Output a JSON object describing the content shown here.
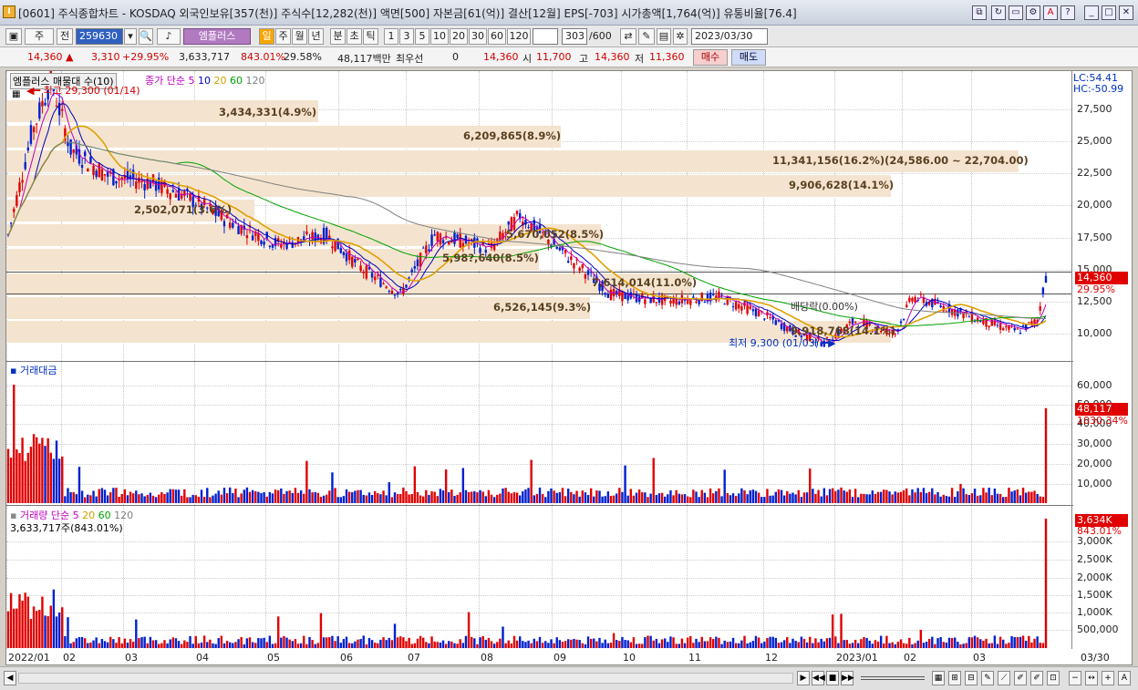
{
  "window": {
    "title": "[0601] 주식종합차트 - KOSDAQ 외국인보유[357(천)] 주식수[12,282(천)] 액면[500] 자본금[61(억)] 결산[12월] EPS[-703] 시가총액[1,764(억)] 유통비율[76.4]",
    "icon": "app-icon"
  },
  "toolbar": {
    "stock_type": "주",
    "period": "전",
    "code": "259630",
    "cond_label": "엠플러스",
    "periods": [
      "일",
      "주",
      "월",
      "년",
      "분",
      "초",
      "틱"
    ],
    "minutes": [
      "1",
      "3",
      "5",
      "10",
      "20",
      "30",
      "60",
      "120"
    ],
    "count": "303",
    "count_total": "/600",
    "date": "2023/03/30"
  },
  "quote": {
    "price": "14,360",
    "change": "3,310",
    "change_pct": "+29.95%",
    "volume": "3,633,717",
    "vol_ratio": "843.01%",
    "turnover": "29.58%",
    "amount": "48,117백만",
    "best_label": "최우선",
    "best_val": "0",
    "open_label": "시",
    "open": "11,700",
    "high_label": "고",
    "high": "14,360",
    "low_label": "저",
    "low": "11,360",
    "buy": "매수",
    "sell": "매도"
  },
  "price_panel": {
    "legend_name": "엠플러스 매물대 수(10)",
    "ma_label": "종가 단순",
    "ma": [
      "5",
      "10",
      "20",
      "60",
      "120"
    ],
    "max_label": "최고 29,300 (01/14)",
    "min_label": "최저 9,300 (01/03)",
    "lc": "LC:54.41",
    "hc": "HC:-50.99",
    "price_tag": "14,360",
    "pct_tag": "29.95%",
    "div_label": "배당락(0.00%)",
    "yticks": [
      "27,500",
      "25,000",
      "22,500",
      "20,000",
      "17,500",
      "15,000",
      "12,500",
      "10,000"
    ],
    "profile": [
      "3,434,331(4.9%)",
      "6,209,865(8.9%)",
      "11,341,156(16.2%)(24,586.00 ~ 22,704.00)",
      "9,906,628(14.1%)",
      "2,502,071(3.6%)",
      "5,670,052(8.5%)",
      "5,98?,640(8.5%)",
      "7,614,014(11.0%)",
      "6,526,145(9.3%)",
      "9,918,768(14.1%)"
    ]
  },
  "amount_panel": {
    "title": "거래대금",
    "value_tag": "48,117",
    "pct_tag": "1030.34%",
    "yticks": [
      "60,000",
      "50,000",
      "40,000",
      "30,000",
      "20,000",
      "10,000"
    ]
  },
  "volume_panel": {
    "title": "거래량",
    "ma_label": "단순",
    "ma": [
      "5",
      "20",
      "60",
      "120"
    ],
    "value_label": "3,633,717주(843.01%)",
    "value_tag": "3,634K",
    "pct_tag": "843.01%",
    "yticks": [
      "3,000K",
      "2,500K",
      "2,000K",
      "1,500K",
      "1,000K",
      "500,000"
    ]
  },
  "xaxis": [
    "2022/01",
    "02",
    "03",
    "04",
    "05",
    "06",
    "07",
    "08",
    "09",
    "10",
    "11",
    "12",
    "2023/01",
    "02",
    "03",
    "03/30"
  ],
  "colors": {
    "up": "#e00000",
    "down": "#0020d0",
    "ma5": "#c000c0",
    "ma10": "#0000c0",
    "ma20": "#e0a000",
    "ma60": "#00a000",
    "ma120": "#808080",
    "profile": "#f4e4cf"
  },
  "chart_data": {
    "type": "candlestick",
    "title": "",
    "price_range": [
      8500,
      29600
    ],
    "start_price": 17500,
    "end_price": 14360,
    "max": 29300,
    "min": 9300,
    "amount_last": 48117,
    "volume_last": 3633717
  }
}
